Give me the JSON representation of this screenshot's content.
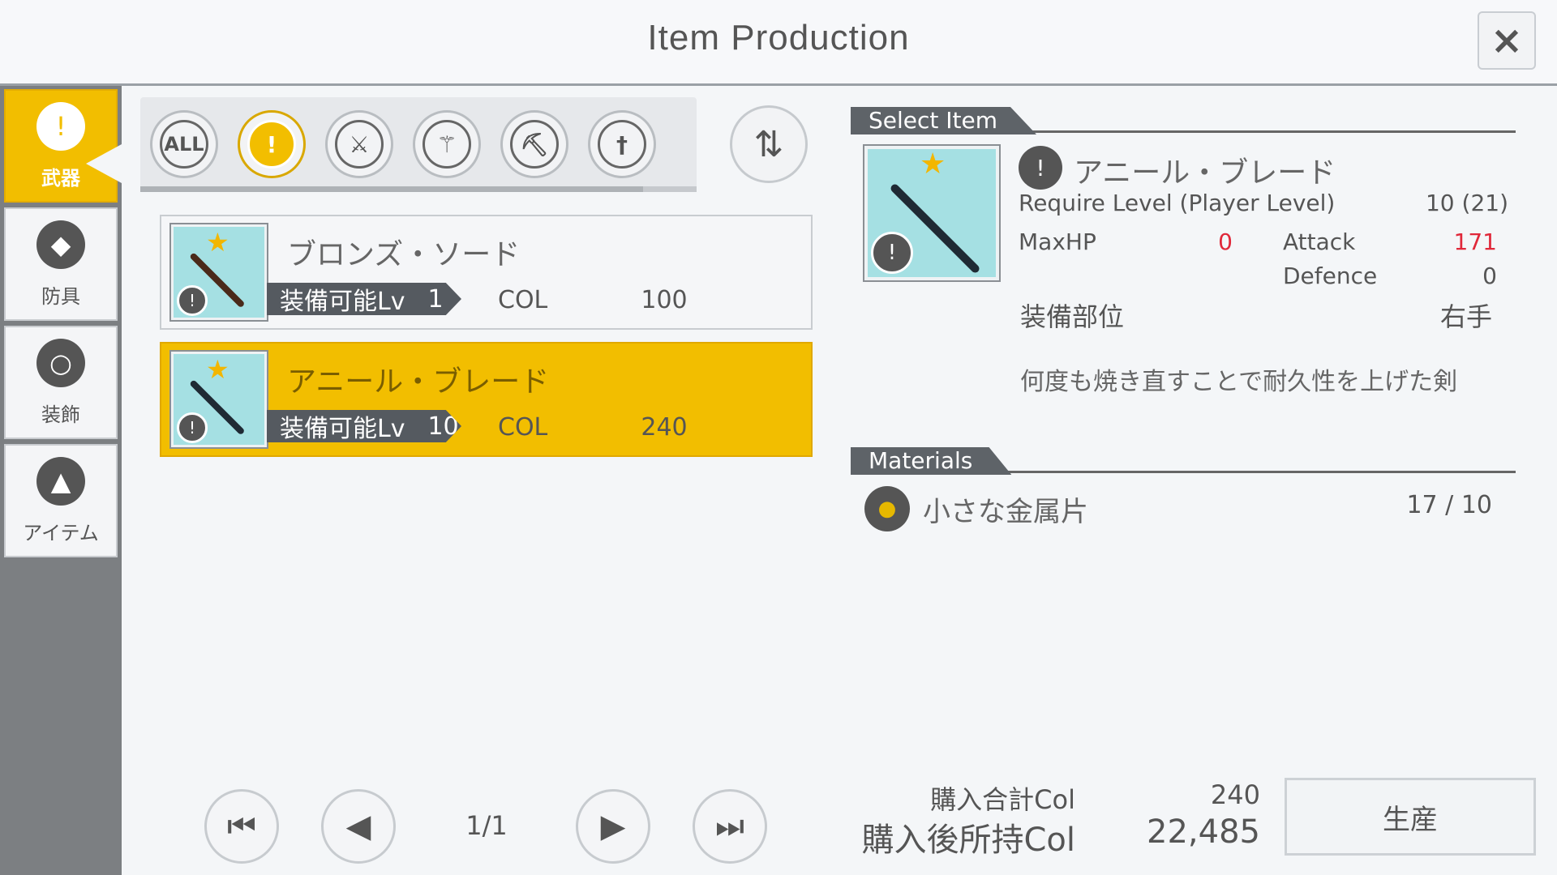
{
  "header": {
    "title": "Item Production",
    "close_icon": "×"
  },
  "categories": [
    {
      "label": "武器",
      "icon": "sword-icon",
      "glyph": "!",
      "active": true
    },
    {
      "label": "防具",
      "icon": "armor-icon",
      "glyph": "◆",
      "active": false
    },
    {
      "label": "装飾",
      "icon": "ring-icon",
      "glyph": "○",
      "active": false
    },
    {
      "label": "アイテム",
      "icon": "bottle-icon",
      "glyph": "▲",
      "active": false
    }
  ],
  "filters": [
    {
      "label": "ALL",
      "icon": "all-icon"
    },
    {
      "label": "!",
      "icon": "one-handed-sword-icon",
      "active": true
    },
    {
      "label": "⚔",
      "icon": "rapier-icon"
    },
    {
      "label": "⚚",
      "icon": "mace-icon"
    },
    {
      "label": "⛏",
      "icon": "axe-icon"
    },
    {
      "label": "†",
      "icon": "spear-icon"
    }
  ],
  "sort_icon": "⇅",
  "items": [
    {
      "name": "ブロンズ・ソード",
      "lv_label": "装備可能Lv",
      "lv": "1",
      "col_label": "COL",
      "col": "100",
      "selected": false
    },
    {
      "name": "アニール・ブレード",
      "lv_label": "装備可能Lv",
      "lv": "10",
      "col_label": "COL",
      "col": "240",
      "selected": true
    }
  ],
  "pagination": {
    "page": "1/1",
    "first": "⏮",
    "prev": "◀",
    "next": "▶",
    "last": "⏭"
  },
  "detail": {
    "section_title": "Select Item",
    "name": "アニール・ブレード",
    "require_label": "Require Level (Player Level)",
    "require_value": "10 (21)",
    "maxhp_label": "MaxHP",
    "maxhp_value": "0",
    "attack_label": "Attack",
    "attack_value": "171",
    "defence_label": "Defence",
    "defence_value": "0",
    "slot_label": "装備部位",
    "slot_value": "右手",
    "description": "何度も焼き直すことで耐久性を上げた剣"
  },
  "materials": {
    "section_title": "Materials",
    "items": [
      {
        "name": "小さな金属片",
        "count": "17 /  10",
        "icon": "pouch-icon"
      }
    ]
  },
  "summary": {
    "total_label": "購入合計Col",
    "total_value": "240",
    "after_label": "購入後所持Col",
    "after_value": "22,485",
    "produce_label": "生産"
  }
}
